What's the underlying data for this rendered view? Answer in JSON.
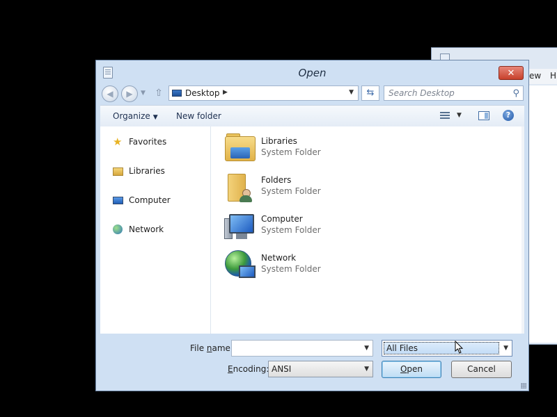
{
  "background_window": {
    "menu_fragment_1": "ew",
    "menu_fragment_2": "H"
  },
  "dialog": {
    "title": "Open",
    "close_glyph": "✕"
  },
  "navigation": {
    "address_crumb": "Desktop",
    "search_placeholder": "Search Desktop"
  },
  "toolbar": {
    "organize_label": "Organize",
    "new_folder_label": "New folder",
    "help_glyph": "?"
  },
  "nav_pane": {
    "items": [
      {
        "label": "Favorites",
        "icon": "star-icon"
      },
      {
        "label": "Libraries",
        "icon": "libraries-icon"
      },
      {
        "label": "Computer",
        "icon": "computer-icon"
      },
      {
        "label": "Network",
        "icon": "network-icon"
      }
    ]
  },
  "content": {
    "items": [
      {
        "name": "Libraries",
        "type": "System Folder",
        "icon": "libraries-folder-icon"
      },
      {
        "name": "Folders",
        "type": "System Folder",
        "icon": "user-folder-icon"
      },
      {
        "name": "Computer",
        "type": "System Folder",
        "icon": "computer-icon"
      },
      {
        "name": "Network",
        "type": "System Folder",
        "icon": "network-globe-icon"
      }
    ]
  },
  "footer": {
    "file_name_label_pre": "File ",
    "file_name_label_u": "n",
    "file_name_label_post": "ame:",
    "file_name_value": "",
    "encoding_label_u": "E",
    "encoding_label_post": "ncoding:",
    "encoding_value": "ANSI",
    "filter_value": "All Files",
    "open_label_u": "O",
    "open_label_post": "pen",
    "cancel_label": "Cancel"
  },
  "colors": {
    "dialog_frame": "#cfe0f3",
    "close_button": "#c7402b",
    "open_button": "#bedcf4"
  }
}
